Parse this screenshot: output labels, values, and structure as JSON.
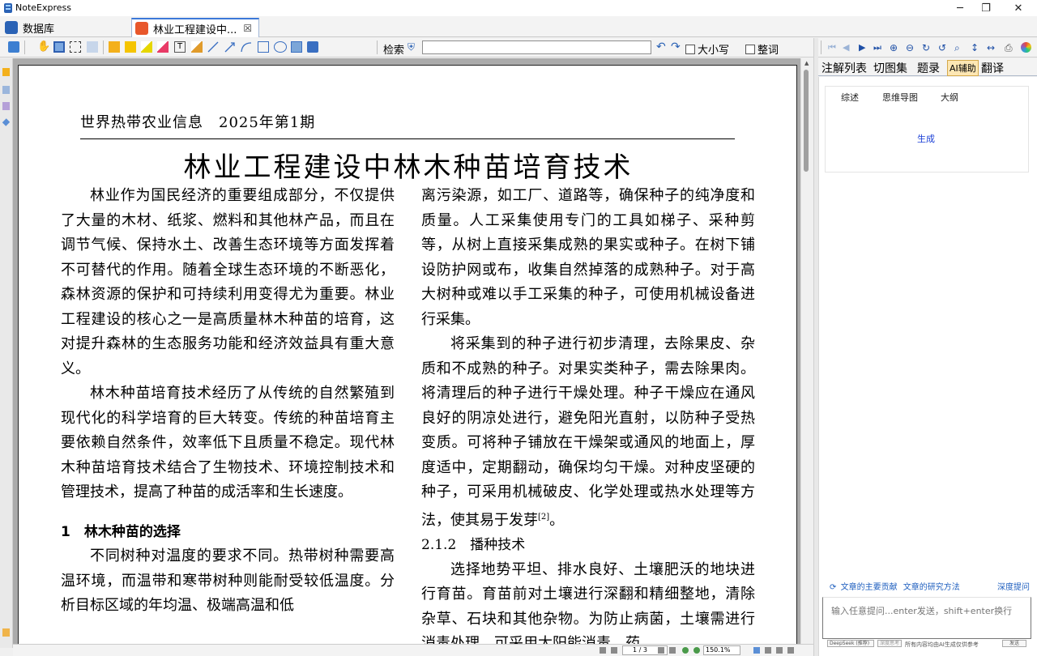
{
  "window": {
    "title": "NoteExpress",
    "minimize": "─",
    "maximize": "❐",
    "close": "✕"
  },
  "tabs": [
    {
      "label": "数据库"
    },
    {
      "label": "林业工程建设中...",
      "close": "☒"
    }
  ],
  "toolbar": {
    "search_label": "检索",
    "search_value": "",
    "case_label": "大小写",
    "word_label": "整词"
  },
  "document": {
    "journal": "世界热带农业信息　2025年第1期",
    "title": "林业工程建设中林木种苗培育技术",
    "left_paragraphs": [
      "林业作为国民经济的重要组成部分，不仅提供了大量的木材、纸浆、燃料和其他林产品，而且在调节气候、保持水土、改善生态环境等方面发挥着不可替代的作用。随着全球生态环境的不断恶化，森林资源的保护和可持续利用变得尤为重要。林业工程建设的核心之一是高质量林木种苗的培育，这对提升森林的生态服务功能和经济效益具有重大意义。",
      "林木种苗培育技术经历了从传统的自然繁殖到现代化的科学培育的巨大转变。传统的种苗培育主要依赖自然条件，效率低下且质量不稳定。现代林木种苗培育技术结合了生物技术、环境控制技术和管理技术，提高了种苗的成活率和生长速度。"
    ],
    "section1_heading": "1　林木种苗的选择",
    "section1_text": "不同树种对温度的要求不同。热带树种需要高温环境，而温带和寒带树种则能耐受较低温度。分析目标区域的年均温、极端高温和低",
    "right_paragraphs": [
      "离污染源，如工厂、道路等，确保种子的纯净度和质量。人工采集使用专门的工具如梯子、采种剪等，从树上直接采集成熟的果实或种子。在树下铺设防护网或布，收集自然掉落的成熟种子。对于高大树种或难以手工采集的种子，可使用机械设备进行采集。",
      "将采集到的种子进行初步清理，去除果皮、杂质和不成熟的种子。对果实类种子，需去除果肉。将清理后的种子进行干燥处理。种子干燥应在通风良好的阴凉处进行，避免阳光直射，以防种子受热变质。可将种子铺放在干燥架或通风的地面上，厚度适中，定期翻动，确保均匀干燥。对种皮坚硬的种子，可采用机械破皮、化学处理或热水处理等方法，使其易于发芽"
    ],
    "citation": "[2]",
    "right_p2_end": "。",
    "subsection_heading": "2.1.2　播种技术",
    "subsection_text": "选择地势平坦、排水良好、土壤肥沃的地块进行育苗。育苗前对土壤进行深翻和精细整地，清除杂草、石块和其他杂物。为防止病菌，土壤需进行消毒处理，可采用太阳能消毒、药"
  },
  "statusbar": {
    "page": "1 / 3",
    "zoom": "150.1%"
  },
  "right_panel": {
    "tabs": [
      "注解列表",
      "切图集",
      "题录",
      "AI辅助",
      "翻译"
    ],
    "active_tab": 3,
    "ai_subtabs": [
      "综述",
      "思维导图",
      "大纲"
    ],
    "generate": "生成",
    "link1": "文章的主要贡献",
    "link2": "文章的研究方法",
    "deep_question": "深度提问",
    "input_placeholder": "输入任意提问...enter发送，shift+enter换行",
    "model": "DeepSeek (推荐)",
    "deep_think": "深度思考",
    "disclaimer": "所有内容均由AI生成仅供参考",
    "send": "发送"
  },
  "colors": {
    "pdf_tab_icon": "#e8572b",
    "active_tab_accent": "#3c78d8",
    "ai_tab_bg": "#fde7b4",
    "link": "#1f5fbf"
  }
}
